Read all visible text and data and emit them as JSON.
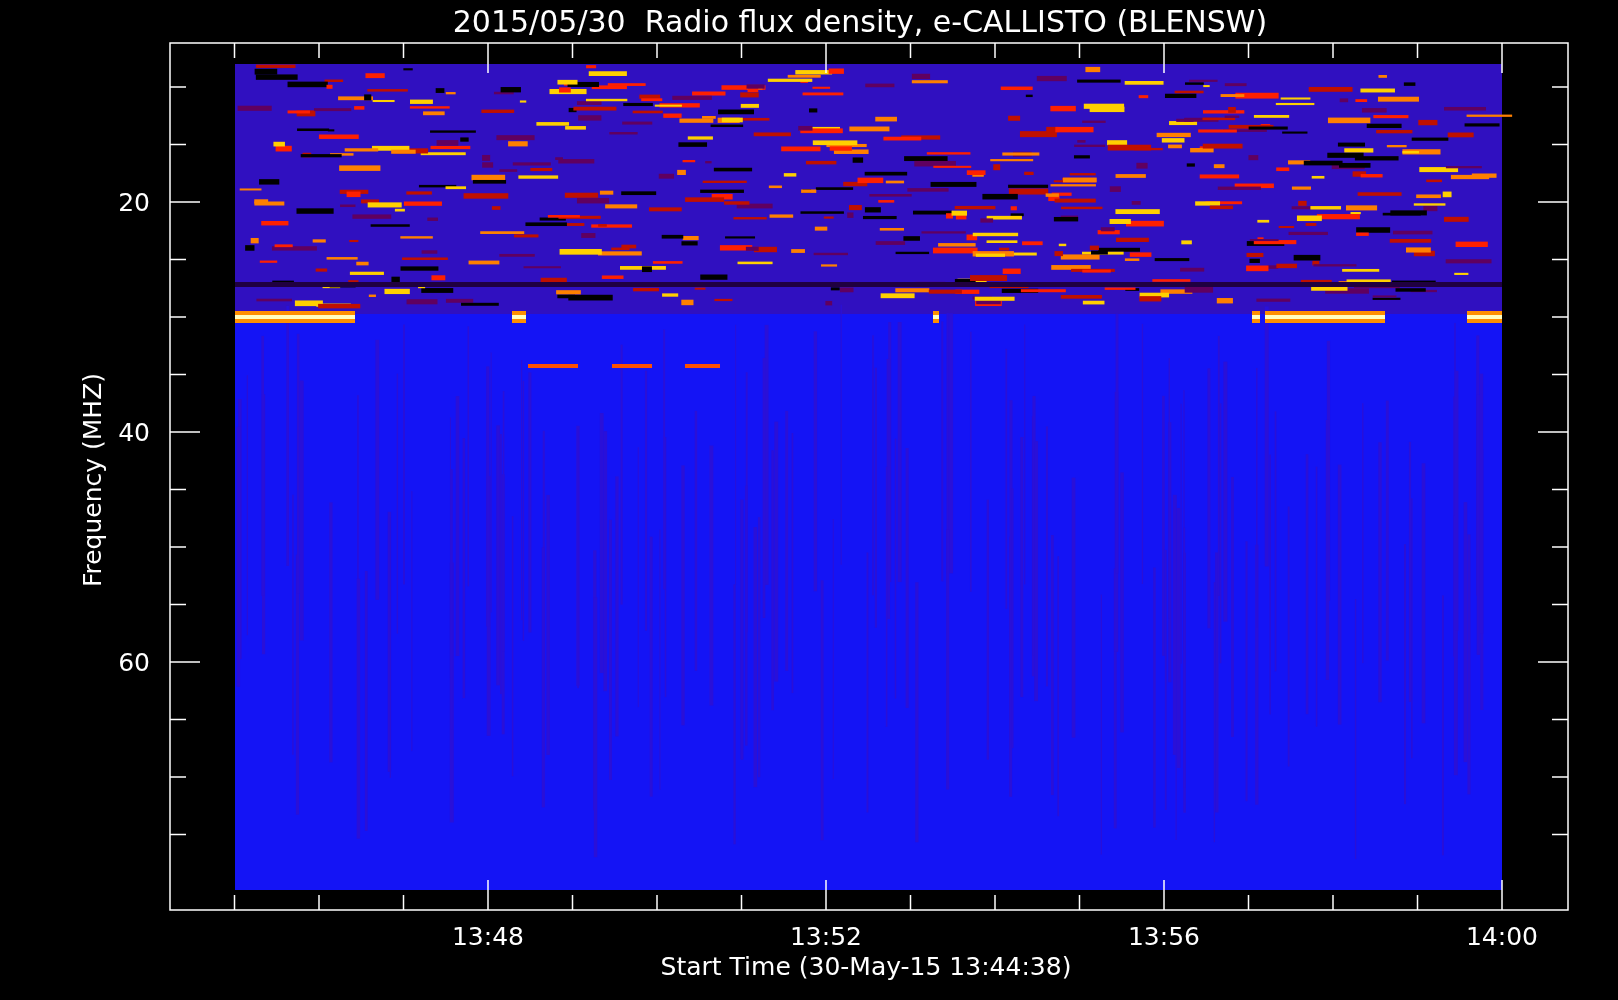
{
  "title": "2015/05/30  Radio flux density, e-CALLISTO (BLENSW)",
  "y_axis": {
    "label": "Frequency (MHZ)",
    "ticks": [
      "20",
      "40",
      "60"
    ]
  },
  "x_axis": {
    "label": "Start Time (30-May-15 13:44:38)",
    "ticks": [
      "13:48",
      "13:52",
      "13:56",
      "14:00"
    ]
  }
}
